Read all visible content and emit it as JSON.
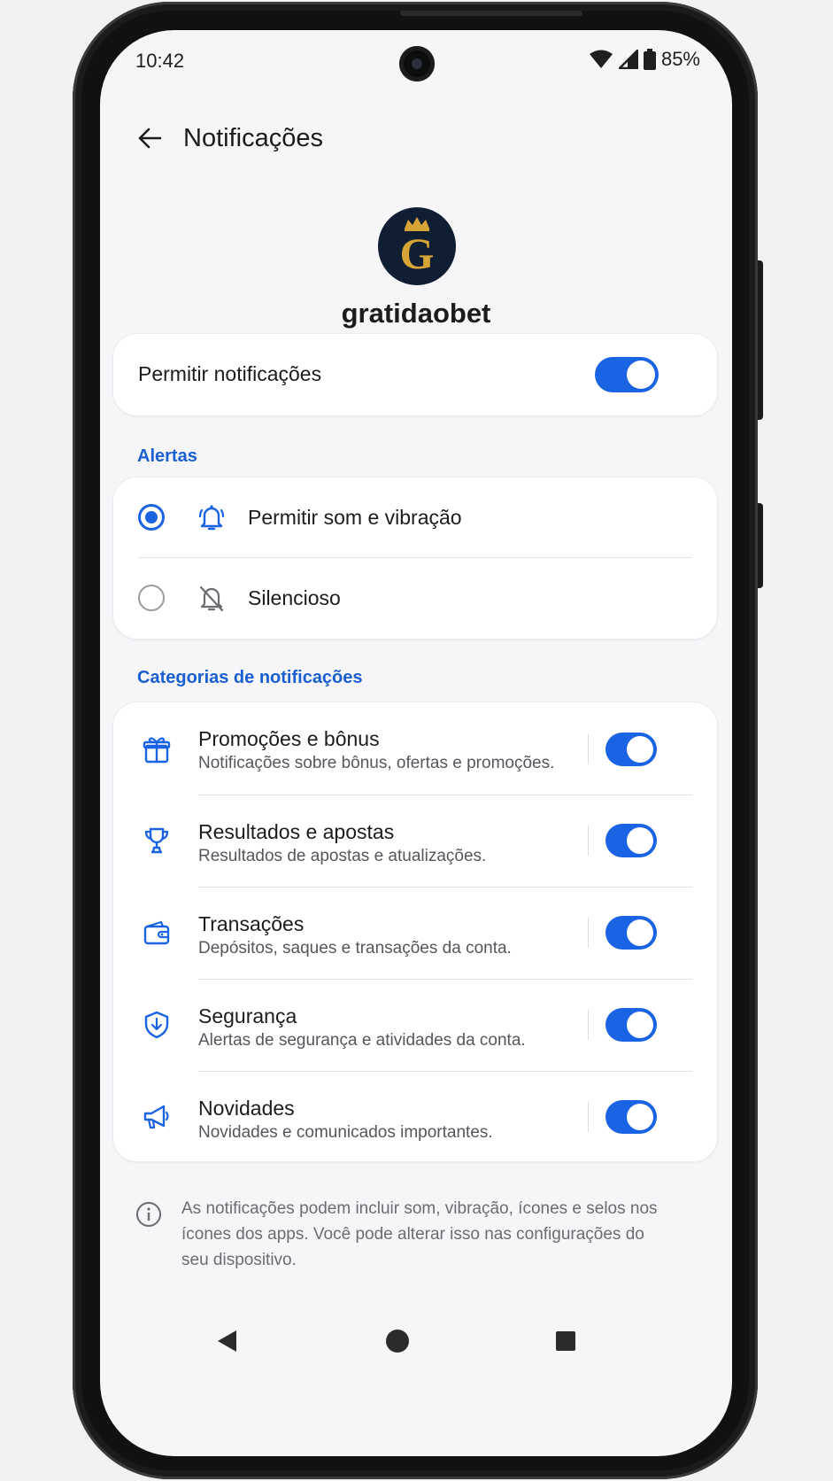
{
  "status_bar": {
    "time": "10:42",
    "battery": "85%"
  },
  "app_bar": {
    "title": "Notificações"
  },
  "app": {
    "name": "gratidaobet",
    "logo_letter": "G"
  },
  "master_toggle": {
    "label": "Permitir notificações",
    "enabled": true
  },
  "alerts": {
    "section_title": "Alertas",
    "options": [
      {
        "label": "Permitir som e vibração",
        "selected": true,
        "icon": "bell-icon"
      },
      {
        "label": "Silencioso",
        "selected": false,
        "icon": "bell-off-icon"
      }
    ]
  },
  "categories": {
    "section_title": "Categorias de notificações",
    "items": [
      {
        "title": "Promoções e bônus",
        "description": "Notificações sobre bônus, ofertas e promoções.",
        "icon": "gift-icon",
        "enabled": true
      },
      {
        "title": "Resultados e apostas",
        "description": "Resultados de apostas e atualizações.",
        "icon": "trophy-icon",
        "enabled": true
      },
      {
        "title": "Transações",
        "description": "Depósitos, saques e transações da conta.",
        "icon": "wallet-icon",
        "enabled": true
      },
      {
        "title": "Segurança",
        "description": "Alertas de segurança e atividades da conta.",
        "icon": "shield-icon",
        "enabled": true
      },
      {
        "title": "Novidades",
        "description": "Novidades e comunicados importantes.",
        "icon": "megaphone-icon",
        "enabled": true
      }
    ]
  },
  "info_note": "As notificações podem incluir som, vibração, ícones e selos nos ícones dos apps. Você pode alterar isso nas configurações do seu dispositivo.",
  "colors": {
    "accent": "#1a63e3",
    "section_label": "#1a5fd1",
    "logo_bg": "#0f1e33",
    "logo_gold": "#d7a536"
  }
}
